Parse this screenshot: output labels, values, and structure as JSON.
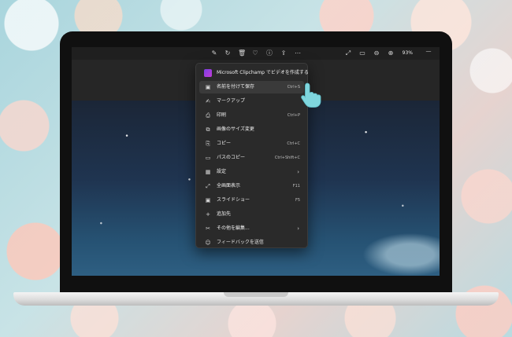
{
  "toolbar": {
    "zoom_level": "93%",
    "icons": [
      "edit-icon",
      "rotate-icon",
      "delete-icon",
      "favorite-icon",
      "info-icon",
      "share-icon",
      "more-icon",
      "fullscreen-icon",
      "slideshow-icon",
      "zoom-out-icon",
      "zoom-in-icon",
      "close-icon"
    ]
  },
  "menu": {
    "items": [
      {
        "label": "Microsoft Clipchamp でビデオを作成する",
        "shortcut": "",
        "icon": "clipchamp-icon"
      },
      {
        "label": "名前を付けて保存",
        "shortcut": "Ctrl+S",
        "icon": "save-as-icon"
      },
      {
        "label": "マークアップ",
        "shortcut": "",
        "icon": "markup-icon"
      },
      {
        "label": "印刷",
        "shortcut": "Ctrl+P",
        "icon": "print-icon"
      },
      {
        "label": "画像のサイズ変更",
        "shortcut": "",
        "icon": "resize-icon"
      },
      {
        "label": "コピー",
        "shortcut": "Ctrl+C",
        "icon": "copy-icon"
      },
      {
        "label": "パスのコピー",
        "shortcut": "Ctrl+Shift+C",
        "icon": "copy-path-icon"
      },
      {
        "label": "設定",
        "shortcut": "",
        "icon": "settings-icon"
      },
      {
        "label": "全画面表示",
        "shortcut": "F11",
        "icon": "fullscreen-icon"
      },
      {
        "label": "スライドショー",
        "shortcut": "F5",
        "icon": "slideshow-icon"
      },
      {
        "label": "追加先",
        "shortcut": "",
        "icon": "add-icon"
      },
      {
        "label": "その他を編集...",
        "shortcut": "",
        "icon": "edit-more-icon"
      },
      {
        "label": "フィードバックを送信",
        "shortcut": "",
        "icon": "feedback-icon"
      }
    ]
  }
}
